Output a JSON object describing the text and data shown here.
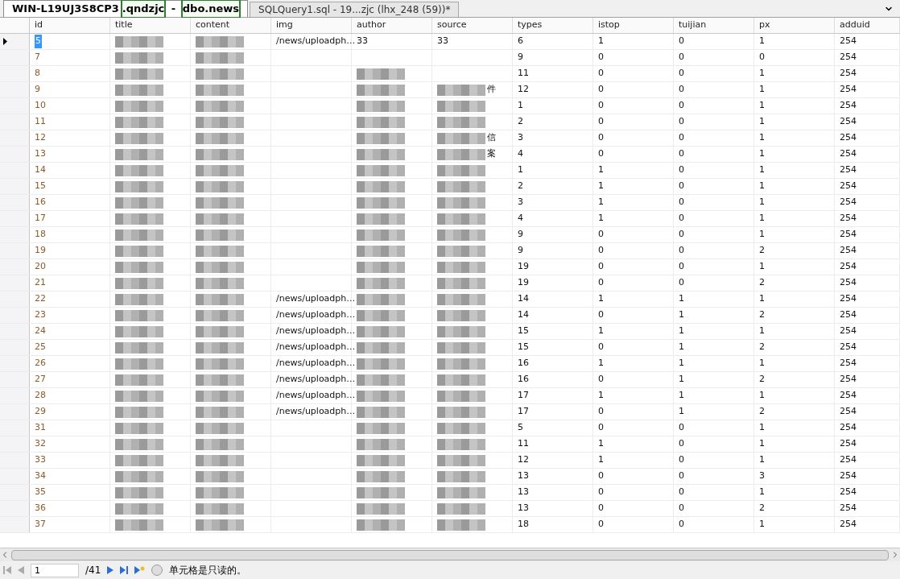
{
  "tabs": [
    {
      "selected": true,
      "segments": [
        {
          "text": "WIN-L19UJ3S8CP3",
          "boxed": false
        },
        {
          "text": ".qndzjc",
          "boxed": true
        },
        {
          "text": " - ",
          "boxed": false
        },
        {
          "text": "dbo.news",
          "boxed": true
        }
      ]
    },
    {
      "selected": false,
      "segments": [
        {
          "text": "SQLQuery1.sql - 19...zjc (lhx_248 (59))*",
          "boxed": false
        }
      ]
    }
  ],
  "table": {
    "columns": [
      "id",
      "title",
      "content",
      "img",
      "author",
      "source",
      "types",
      "istop",
      "tuijian",
      "px",
      "adduid"
    ],
    "rows": [
      {
        "selected": true,
        "cells": [
          "5",
          "",
          "",
          "/news/uploadph…",
          "33",
          "33",
          "6",
          "1",
          "0",
          "1",
          "254"
        ],
        "pixelated": [
          false,
          true,
          true,
          false,
          false,
          false,
          false,
          false,
          false,
          false,
          false
        ]
      },
      {
        "selected": false,
        "cells": [
          "7",
          "",
          "",
          "",
          "",
          "",
          "9",
          "0",
          "0",
          "0",
          "254"
        ],
        "pixelated": [
          false,
          true,
          true,
          false,
          false,
          false,
          false,
          false,
          false,
          false,
          false
        ]
      },
      {
        "selected": false,
        "cells": [
          "8",
          "",
          "",
          "",
          "",
          "",
          "11",
          "0",
          "0",
          "1",
          "254"
        ],
        "pixelated": [
          false,
          true,
          true,
          false,
          true,
          false,
          false,
          false,
          false,
          false,
          false
        ]
      },
      {
        "selected": false,
        "cells": [
          "9",
          "",
          "",
          "",
          "",
          "件",
          "12",
          "0",
          "0",
          "1",
          "254"
        ],
        "pixelated": [
          false,
          true,
          true,
          false,
          true,
          true,
          false,
          false,
          false,
          false,
          false
        ]
      },
      {
        "selected": false,
        "cells": [
          "10",
          "",
          "",
          "",
          "",
          "",
          "1",
          "0",
          "0",
          "1",
          "254"
        ],
        "pixelated": [
          false,
          true,
          true,
          false,
          true,
          true,
          false,
          false,
          false,
          false,
          false
        ]
      },
      {
        "selected": false,
        "cells": [
          "11",
          "",
          "",
          "",
          "",
          "",
          "2",
          "0",
          "0",
          "1",
          "254"
        ],
        "pixelated": [
          false,
          true,
          true,
          false,
          true,
          true,
          false,
          false,
          false,
          false,
          false
        ]
      },
      {
        "selected": false,
        "cells": [
          "12",
          "",
          "",
          "",
          "",
          "信",
          "3",
          "0",
          "0",
          "1",
          "254"
        ],
        "pixelated": [
          false,
          true,
          true,
          false,
          true,
          true,
          false,
          false,
          false,
          false,
          false
        ]
      },
      {
        "selected": false,
        "cells": [
          "13",
          "",
          "",
          "",
          "",
          "案",
          "4",
          "0",
          "0",
          "1",
          "254"
        ],
        "pixelated": [
          false,
          true,
          true,
          false,
          true,
          true,
          false,
          false,
          false,
          false,
          false
        ]
      },
      {
        "selected": false,
        "cells": [
          "14",
          "",
          "",
          "",
          "",
          "",
          "1",
          "1",
          "0",
          "1",
          "254"
        ],
        "pixelated": [
          false,
          true,
          true,
          false,
          true,
          true,
          false,
          false,
          false,
          false,
          false
        ]
      },
      {
        "selected": false,
        "cells": [
          "15",
          "",
          "",
          "",
          "",
          "",
          "2",
          "1",
          "0",
          "1",
          "254"
        ],
        "pixelated": [
          false,
          true,
          true,
          false,
          true,
          true,
          false,
          false,
          false,
          false,
          false
        ]
      },
      {
        "selected": false,
        "cells": [
          "16",
          "",
          "",
          "",
          "",
          "",
          "3",
          "1",
          "0",
          "1",
          "254"
        ],
        "pixelated": [
          false,
          true,
          true,
          false,
          true,
          true,
          false,
          false,
          false,
          false,
          false
        ]
      },
      {
        "selected": false,
        "cells": [
          "17",
          "",
          "",
          "",
          "",
          "",
          "4",
          "1",
          "0",
          "1",
          "254"
        ],
        "pixelated": [
          false,
          true,
          true,
          false,
          true,
          true,
          false,
          false,
          false,
          false,
          false
        ]
      },
      {
        "selected": false,
        "cells": [
          "18",
          "",
          "",
          "",
          "",
          "",
          "9",
          "0",
          "0",
          "1",
          "254"
        ],
        "pixelated": [
          false,
          true,
          true,
          false,
          true,
          true,
          false,
          false,
          false,
          false,
          false
        ]
      },
      {
        "selected": false,
        "cells": [
          "19",
          "",
          "",
          "",
          "",
          "",
          "9",
          "0",
          "0",
          "2",
          "254"
        ],
        "pixelated": [
          false,
          true,
          true,
          false,
          true,
          true,
          false,
          false,
          false,
          false,
          false
        ]
      },
      {
        "selected": false,
        "cells": [
          "20",
          "",
          "",
          "",
          "",
          "",
          "19",
          "0",
          "0",
          "1",
          "254"
        ],
        "pixelated": [
          false,
          true,
          true,
          false,
          true,
          true,
          false,
          false,
          false,
          false,
          false
        ]
      },
      {
        "selected": false,
        "cells": [
          "21",
          "",
          "",
          "",
          "",
          "",
          "19",
          "0",
          "0",
          "2",
          "254"
        ],
        "pixelated": [
          false,
          true,
          true,
          false,
          true,
          true,
          false,
          false,
          false,
          false,
          false
        ]
      },
      {
        "selected": false,
        "cells": [
          "22",
          "",
          "",
          "/news/uploadph…",
          "",
          "",
          "14",
          "1",
          "1",
          "1",
          "254"
        ],
        "pixelated": [
          false,
          true,
          true,
          false,
          true,
          true,
          false,
          false,
          false,
          false,
          false
        ]
      },
      {
        "selected": false,
        "cells": [
          "23",
          "",
          "",
          "/news/uploadph…",
          "",
          "",
          "14",
          "0",
          "1",
          "2",
          "254"
        ],
        "pixelated": [
          false,
          true,
          true,
          false,
          true,
          true,
          false,
          false,
          false,
          false,
          false
        ]
      },
      {
        "selected": false,
        "cells": [
          "24",
          "",
          "",
          "/news/uploadph…",
          "",
          "",
          "15",
          "1",
          "1",
          "1",
          "254"
        ],
        "pixelated": [
          false,
          true,
          true,
          false,
          true,
          true,
          false,
          false,
          false,
          false,
          false
        ]
      },
      {
        "selected": false,
        "cells": [
          "25",
          "",
          "",
          "/news/uploadph…",
          "",
          "",
          "15",
          "0",
          "1",
          "2",
          "254"
        ],
        "pixelated": [
          false,
          true,
          true,
          false,
          true,
          true,
          false,
          false,
          false,
          false,
          false
        ]
      },
      {
        "selected": false,
        "cells": [
          "26",
          "",
          "",
          "/news/uploadph…",
          "",
          "",
          "16",
          "1",
          "1",
          "1",
          "254"
        ],
        "pixelated": [
          false,
          true,
          true,
          false,
          true,
          true,
          false,
          false,
          false,
          false,
          false
        ]
      },
      {
        "selected": false,
        "cells": [
          "27",
          "",
          "",
          "/news/uploadph…",
          "",
          "",
          "16",
          "0",
          "1",
          "2",
          "254"
        ],
        "pixelated": [
          false,
          true,
          true,
          false,
          true,
          true,
          false,
          false,
          false,
          false,
          false
        ]
      },
      {
        "selected": false,
        "cells": [
          "28",
          "",
          "",
          "/news/uploadph…",
          "",
          "",
          "17",
          "1",
          "1",
          "1",
          "254"
        ],
        "pixelated": [
          false,
          true,
          true,
          false,
          true,
          true,
          false,
          false,
          false,
          false,
          false
        ]
      },
      {
        "selected": false,
        "cells": [
          "29",
          "",
          "",
          "/news/uploadph…",
          "",
          "",
          "17",
          "0",
          "1",
          "2",
          "254"
        ],
        "pixelated": [
          false,
          true,
          true,
          false,
          true,
          true,
          false,
          false,
          false,
          false,
          false
        ]
      },
      {
        "selected": false,
        "cells": [
          "31",
          "",
          "",
          "",
          "",
          "",
          "5",
          "0",
          "0",
          "1",
          "254"
        ],
        "pixelated": [
          false,
          true,
          true,
          false,
          true,
          true,
          false,
          false,
          false,
          false,
          false
        ]
      },
      {
        "selected": false,
        "cells": [
          "32",
          "",
          "",
          "",
          "",
          "",
          "11",
          "1",
          "0",
          "1",
          "254"
        ],
        "pixelated": [
          false,
          true,
          true,
          false,
          true,
          true,
          false,
          false,
          false,
          false,
          false
        ]
      },
      {
        "selected": false,
        "cells": [
          "33",
          "",
          "",
          "",
          "",
          "",
          "12",
          "1",
          "0",
          "1",
          "254"
        ],
        "pixelated": [
          false,
          true,
          true,
          false,
          true,
          true,
          false,
          false,
          false,
          false,
          false
        ]
      },
      {
        "selected": false,
        "cells": [
          "34",
          "",
          "",
          "",
          "",
          "",
          "13",
          "0",
          "0",
          "3",
          "254"
        ],
        "pixelated": [
          false,
          true,
          true,
          false,
          true,
          true,
          false,
          false,
          false,
          false,
          false
        ]
      },
      {
        "selected": false,
        "cells": [
          "35",
          "",
          "",
          "",
          "",
          "",
          "13",
          "0",
          "0",
          "1",
          "254"
        ],
        "pixelated": [
          false,
          true,
          true,
          false,
          true,
          true,
          false,
          false,
          false,
          false,
          false
        ]
      },
      {
        "selected": false,
        "cells": [
          "36",
          "",
          "",
          "",
          "",
          "",
          "13",
          "0",
          "0",
          "2",
          "254"
        ],
        "pixelated": [
          false,
          true,
          true,
          false,
          true,
          true,
          false,
          false,
          false,
          false,
          false
        ]
      },
      {
        "selected": false,
        "cells": [
          "37",
          "",
          "",
          "",
          "",
          "",
          "18",
          "0",
          "0",
          "1",
          "254"
        ],
        "pixelated": [
          false,
          true,
          true,
          false,
          true,
          true,
          false,
          false,
          false,
          false,
          false
        ]
      }
    ]
  },
  "status_bar": {
    "record": "1",
    "total": "/41",
    "message": "单元格是只读的。"
  }
}
